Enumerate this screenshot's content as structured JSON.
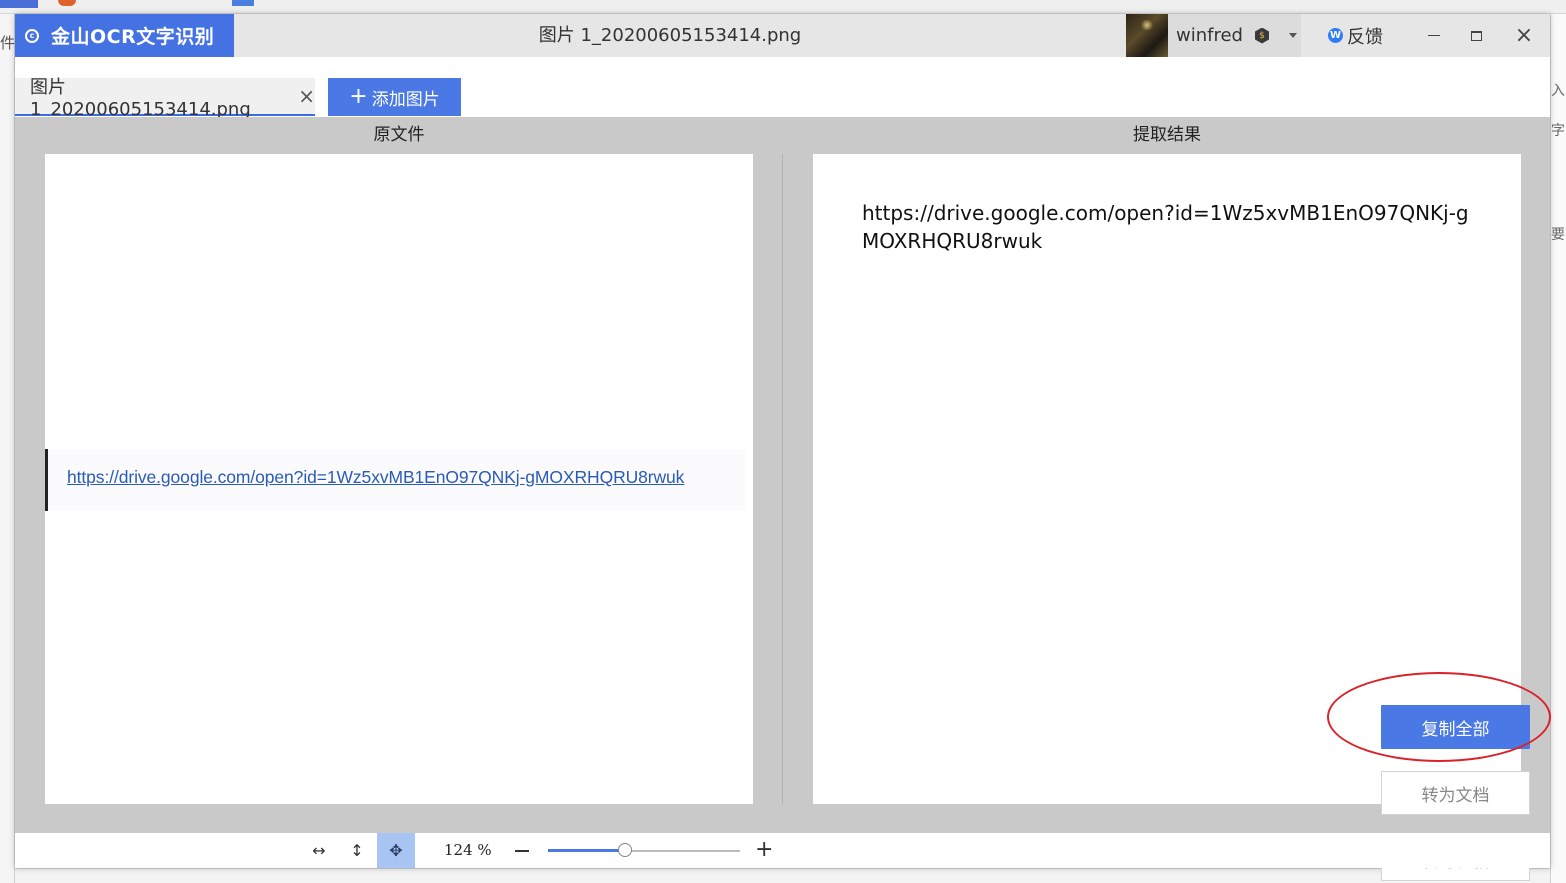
{
  "app": {
    "brand_name": "金山OCR文字识别",
    "window_title": "图片 1_20200605153414.png",
    "user_name": "winfred",
    "feedback_label": "反馈"
  },
  "tabs": {
    "file_tab_label": "图片 1_20200605153414.png",
    "add_image_label": "添加图片"
  },
  "panels": {
    "original_title": "原文件",
    "result_title": "提取结果",
    "image_link_text": "https://drive.google.com/open?id=1Wz5xvMB1EnO97QNKj-gMOXRHQRU8rwuk",
    "result_text": "https://drive.google.com/open?id=1Wz5xvMB1EnO97QNKj-gMOXRHQRU8rwuk"
  },
  "actions": {
    "copy_all": "复制全部",
    "to_document": "转为文档",
    "to_table": "转为表格"
  },
  "footer": {
    "zoom_label": "124 %",
    "zoom_level": 0.4
  },
  "background": {
    "left_edge_char": "件",
    "right_edge_chars": [
      "入",
      "字",
      "要"
    ]
  },
  "colors": {
    "accent": "#4a79e6",
    "annotation": "#d9232a"
  },
  "icons": {
    "brand_logo": "copyright-circle-icon",
    "vip": "vip-badge-icon",
    "feedback": "w-circle-icon",
    "fit_width": "horizontal-arrows-icon",
    "fit_height": "vertical-arrows-icon",
    "pan": "move-cross-icon"
  }
}
